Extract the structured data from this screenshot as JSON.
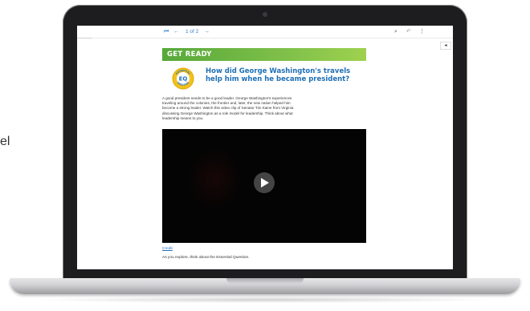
{
  "side_text": "el",
  "toolbar": {
    "first_icon": "first-page-icon",
    "prev_icon": "previous-page-icon",
    "page_indicator": "1 of 2",
    "next_icon": "next-page-icon",
    "search_icon": "search-icon",
    "share_icon": "share-icon",
    "more_icon": "more-options-icon",
    "collapse_icon": "collapse-panel-icon"
  },
  "lesson": {
    "banner": "GET READY",
    "badge": {
      "center": "EQ",
      "top_arc": "ESSENTIAL",
      "bottom_arc": "QUESTION"
    },
    "question": "How did George Washington's travels help him when he became president?",
    "intro": "A good president needs to be a good leader. George Washington's experiences traveling around the colonies, the frontier and, later, the new nation helped him become a strong leader. Watch this video clip of Senator Tim Kaine from Virginia discussing George Washington as a role model for leadership. Think about what leadership means to you.",
    "credit": "Credit",
    "explore": "As you explore, think about the Essential Question."
  },
  "colors": {
    "banner_start": "#56a83a",
    "banner_end": "#9ed14f",
    "question_blue": "#1f6fb5",
    "toolbar_blue": "#3a7fd6",
    "laptop_bezel": "#1d1d1f",
    "badge_yellow": "#f3c11b"
  }
}
